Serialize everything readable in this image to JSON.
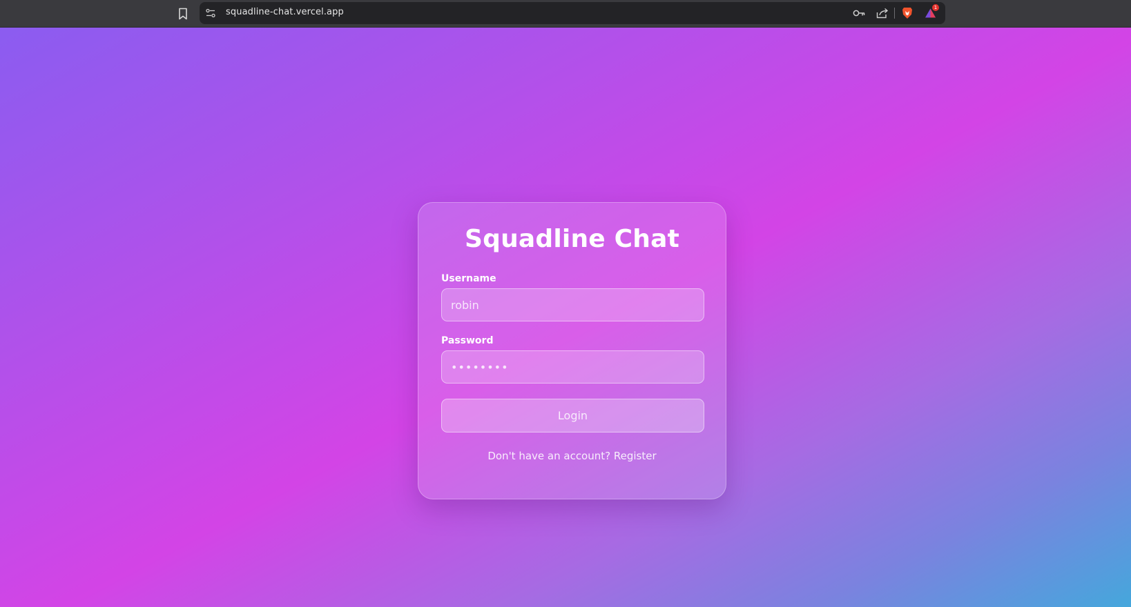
{
  "browser": {
    "url": "squadline-chat.vercel.app",
    "badge_count": "1",
    "icons": [
      "bookmark-icon",
      "site-settings-icon",
      "key-icon",
      "share-icon",
      "brave-shield-icon",
      "brave-rewards-icon"
    ]
  },
  "login": {
    "title": "Squadline Chat",
    "username_label": "Username",
    "username_value": "robin",
    "password_label": "Password",
    "password_value": "••••••••",
    "login_button": "Login",
    "register_prompt": "Don't have an account?",
    "register_link": "Register"
  },
  "colors": {
    "gradient": [
      "#8b5cf0",
      "#d344e6",
      "#45a7dc"
    ],
    "text": "#ffffff",
    "browser_bar": "#3a3a3e",
    "url_bar": "#232326"
  }
}
